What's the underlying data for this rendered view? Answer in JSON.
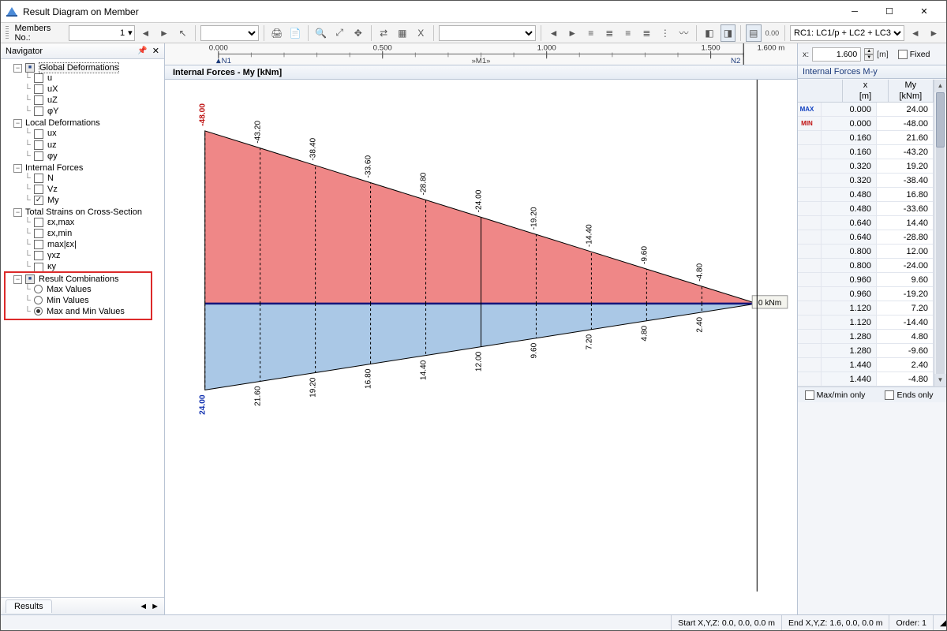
{
  "window": {
    "title": "Result Diagram on Member"
  },
  "toolbar": {
    "members_label": "Members No.:",
    "members_value": "1",
    "load_combo": "RC1: LC1/p + LC2 + LC3"
  },
  "navigator": {
    "title": "Navigator",
    "results_tab": "Results",
    "tree": {
      "global": {
        "label": "Global Deformations",
        "items": [
          "u",
          "uX",
          "uZ",
          "φY"
        ]
      },
      "local": {
        "label": "Local Deformations",
        "items": [
          "ux",
          "uz",
          "φy"
        ]
      },
      "forces": {
        "label": "Internal Forces",
        "items": [
          "N",
          "Vz",
          "My"
        ],
        "checked": "My"
      },
      "strains": {
        "label": "Total Strains on Cross-Section",
        "items": [
          "εx,max",
          "εx,min",
          "max|εx|",
          "γxz",
          "κy"
        ]
      },
      "rc": {
        "label": "Result Combinations",
        "options": [
          "Max Values",
          "Min Values",
          "Max and Min Values"
        ],
        "selected": 2
      }
    }
  },
  "ruler": {
    "ticks": [
      "0.000",
      "0.500",
      "1.000",
      "1.500"
    ],
    "end_label": "1.600 m",
    "member_label": "»M1»",
    "node_start": "N1",
    "node_end": "N2"
  },
  "chart_data": {
    "type": "area",
    "title": "Internal Forces - My [kNm]",
    "xlabel": "x [m]",
    "ylabel": "My [kNm]",
    "x_range": [
      0.0,
      1.6
    ],
    "baseline_label": "0 kNm",
    "series": [
      {
        "name": "min",
        "color": "#ed7f7f",
        "x": [
          0.0,
          0.16,
          0.32,
          0.48,
          0.64,
          0.8,
          0.96,
          1.12,
          1.28,
          1.44,
          1.6
        ],
        "values": [
          -48.0,
          -43.2,
          -38.4,
          -33.6,
          -28.8,
          -24.0,
          -19.2,
          -14.4,
          -9.6,
          -4.8,
          0.0
        ]
      },
      {
        "name": "max",
        "color": "#a9c9e8",
        "x": [
          0.0,
          0.16,
          0.32,
          0.48,
          0.64,
          0.8,
          0.96,
          1.12,
          1.28,
          1.44,
          1.6
        ],
        "values": [
          24.0,
          21.6,
          19.2,
          16.8,
          14.4,
          12.0,
          9.6,
          7.2,
          4.8,
          2.4,
          0.0
        ]
      }
    ],
    "neg_labels": [
      "-48.00",
      "-43.20",
      "-38.40",
      "-33.60",
      "-28.80",
      "-24.00",
      "-19.20",
      "-14.40",
      "-9.60",
      "-4.80"
    ],
    "pos_labels": [
      "24.00",
      "21.60",
      "19.20",
      "16.80",
      "14.40",
      "12.00",
      "9.60",
      "7.20",
      "4.80",
      "2.40"
    ]
  },
  "infobar": {
    "x_label": "x:",
    "x_value": "1.600",
    "x_unit": "[m]",
    "fixed_label": "Fixed"
  },
  "table": {
    "title": "Internal Forces M-y",
    "col_x_hdr": "x",
    "col_x_unit": "[m]",
    "col_m_hdr": "My",
    "col_m_unit": "[kNm]",
    "rows": [
      {
        "tag": "MAX",
        "tagcolor": "#1040c0",
        "x": "0.000",
        "m": "24.00"
      },
      {
        "tag": "MIN",
        "tagcolor": "#c01010",
        "x": "0.000",
        "m": "-48.00"
      },
      {
        "tag": "",
        "x": "0.160",
        "m": "21.60"
      },
      {
        "tag": "",
        "x": "0.160",
        "m": "-43.20"
      },
      {
        "tag": "",
        "x": "0.320",
        "m": "19.20"
      },
      {
        "tag": "",
        "x": "0.320",
        "m": "-38.40"
      },
      {
        "tag": "",
        "x": "0.480",
        "m": "16.80"
      },
      {
        "tag": "",
        "x": "0.480",
        "m": "-33.60"
      },
      {
        "tag": "",
        "x": "0.640",
        "m": "14.40"
      },
      {
        "tag": "",
        "x": "0.640",
        "m": "-28.80"
      },
      {
        "tag": "",
        "x": "0.800",
        "m": "12.00"
      },
      {
        "tag": "",
        "x": "0.800",
        "m": "-24.00"
      },
      {
        "tag": "",
        "x": "0.960",
        "m": "9.60"
      },
      {
        "tag": "",
        "x": "0.960",
        "m": "-19.20"
      },
      {
        "tag": "",
        "x": "1.120",
        "m": "7.20"
      },
      {
        "tag": "",
        "x": "1.120",
        "m": "-14.40"
      },
      {
        "tag": "",
        "x": "1.280",
        "m": "4.80"
      },
      {
        "tag": "",
        "x": "1.280",
        "m": "-9.60"
      },
      {
        "tag": "",
        "x": "1.440",
        "m": "2.40"
      },
      {
        "tag": "",
        "x": "1.440",
        "m": "-4.80"
      }
    ],
    "footer_left": "Max/min only",
    "footer_right": "Ends only"
  },
  "status": {
    "start": "Start X,Y,Z:   0.0, 0.0, 0.0 m",
    "end": "End X,Y,Z:   1.6, 0.0, 0.0 m",
    "order": "Order:   1"
  }
}
